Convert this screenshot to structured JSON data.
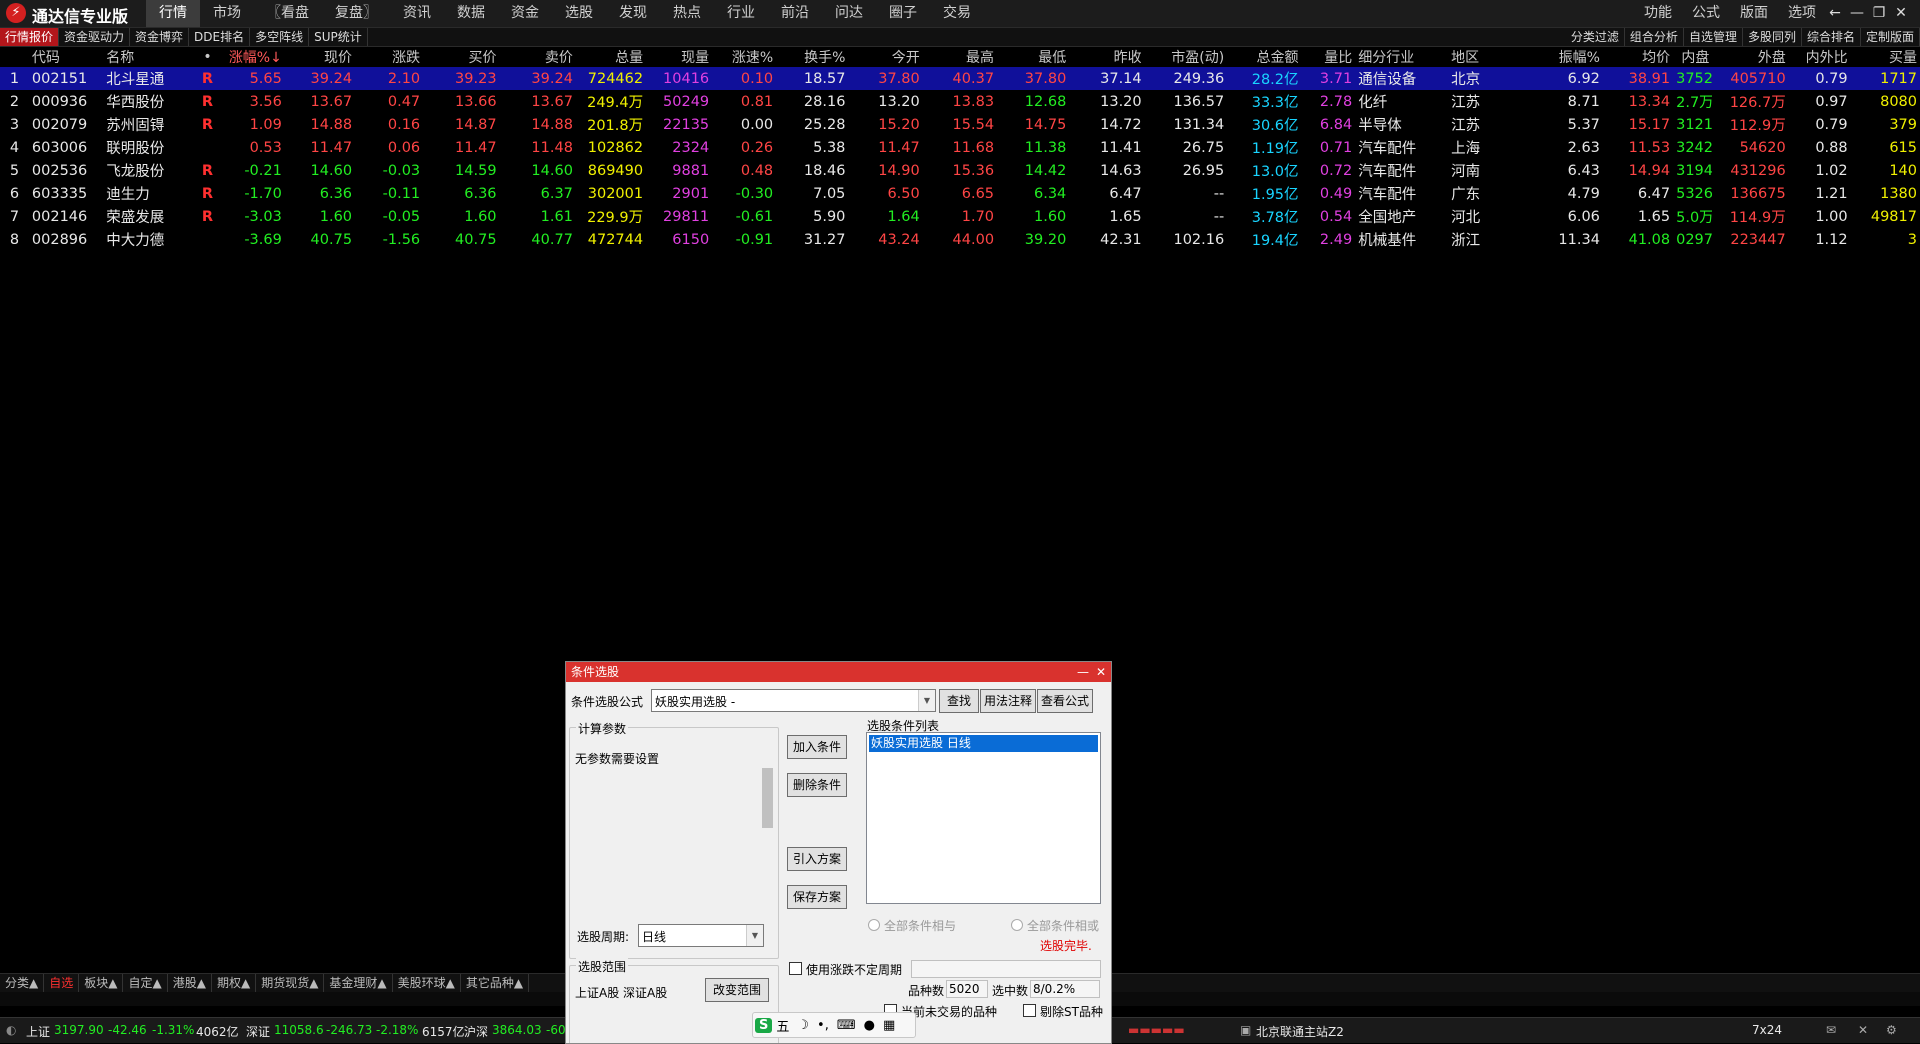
{
  "app": {
    "logo_icon": "tdx-logo-icon",
    "title": "通达信专业版",
    "menu": [
      "行情",
      "市场",
      "〖看盘",
      "复盘〗",
      "资讯",
      "数据",
      "资金",
      "选股",
      "发现",
      "热点",
      "行业",
      "前沿",
      "问达",
      "圈子",
      "交易"
    ],
    "right_menu": [
      "功能",
      "公式",
      "版面",
      "选项"
    ],
    "window_controls": [
      "←",
      "—",
      "❐",
      "✕"
    ]
  },
  "subtabs": [
    "行情报价",
    "资金驱动力",
    "资金博弈",
    "DDE排名",
    "多空阵线",
    "SUP统计"
  ],
  "subtabs_right": [
    "分类过滤",
    "组合分析",
    "自选管理",
    "多股同列",
    "综合排名",
    "定制版面"
  ],
  "table": {
    "headers": [
      "",
      "代码",
      "名称",
      "•",
      "涨幅%↓",
      "现价",
      "涨跌",
      "买价",
      "卖价",
      "总量",
      "现量",
      "涨速%",
      "换手%",
      "今开",
      "最高",
      "最低",
      "昨收",
      "市盈(动)",
      "总金额",
      "量比",
      "细分行业",
      "地区",
      "振幅%",
      "均价",
      "内盘",
      "外盘",
      "内外比",
      "买量"
    ],
    "rows": [
      [
        "1",
        "002151",
        "北斗星通",
        "R",
        "5.65",
        "39.24",
        "2.10",
        "39.23",
        "39.24",
        "724462",
        "10416",
        "0.10",
        "18.57",
        "37.80",
        "40.37",
        "37.80",
        "37.14",
        "249.36",
        "28.2亿",
        "3.71",
        "通信设备",
        "北京",
        "6.92",
        "38.91",
        "3752",
        "405710",
        "0.79",
        "1717"
      ],
      [
        "2",
        "000936",
        "华西股份",
        "R",
        "3.56",
        "13.67",
        "0.47",
        "13.66",
        "13.67",
        "249.4万",
        "50249",
        "0.81",
        "28.16",
        "13.20",
        "13.83",
        "12.68",
        "13.20",
        "136.57",
        "33.3亿",
        "2.78",
        "化纤",
        "江苏",
        "8.71",
        "13.34",
        "2.7万",
        "126.7万",
        "0.97",
        "8080"
      ],
      [
        "3",
        "002079",
        "苏州固锝",
        "R",
        "1.09",
        "14.88",
        "0.16",
        "14.87",
        "14.88",
        "201.8万",
        "22135",
        "0.00",
        "25.28",
        "15.20",
        "15.54",
        "14.75",
        "14.72",
        "131.34",
        "30.6亿",
        "6.84",
        "半导体",
        "江苏",
        "5.37",
        "15.17",
        "3121",
        "112.9万",
        "0.79",
        "379"
      ],
      [
        "4",
        "603006",
        "联明股份",
        "",
        "0.53",
        "11.47",
        "0.06",
        "11.47",
        "11.48",
        "102862",
        "2324",
        "0.26",
        "5.38",
        "11.47",
        "11.68",
        "11.38",
        "11.41",
        "26.75",
        "1.19亿",
        "0.71",
        "汽车配件",
        "上海",
        "2.63",
        "11.53",
        "3242",
        "54620",
        "0.88",
        "615"
      ],
      [
        "5",
        "002536",
        "飞龙股份",
        "R",
        "-0.21",
        "14.60",
        "-0.03",
        "14.59",
        "14.60",
        "869490",
        "9881",
        "0.48",
        "18.46",
        "14.90",
        "15.36",
        "14.42",
        "14.63",
        "26.95",
        "13.0亿",
        "0.72",
        "汽车配件",
        "河南",
        "6.43",
        "14.94",
        "3194",
        "431296",
        "1.02",
        "140"
      ],
      [
        "6",
        "603335",
        "迪生力",
        "R",
        "-1.70",
        "6.36",
        "-0.11",
        "6.36",
        "6.37",
        "302001",
        "2901",
        "-0.30",
        "7.05",
        "6.50",
        "6.65",
        "6.34",
        "6.47",
        "--",
        "1.95亿",
        "0.49",
        "汽车配件",
        "广东",
        "4.79",
        "6.47",
        "5326",
        "136675",
        "1.21",
        "1380"
      ],
      [
        "7",
        "002146",
        "荣盛发展",
        "R",
        "-3.03",
        "1.60",
        "-0.05",
        "1.60",
        "1.61",
        "229.9万",
        "29811",
        "-0.61",
        "5.90",
        "1.64",
        "1.70",
        "1.60",
        "1.65",
        "--",
        "3.78亿",
        "0.54",
        "全国地产",
        "河北",
        "6.06",
        "1.65",
        "5.0万",
        "114.9万",
        "1.00",
        "49817"
      ],
      [
        "8",
        "002896",
        "中大力德",
        "",
        "-3.69",
        "40.75",
        "-1.56",
        "40.75",
        "40.77",
        "472744",
        "6150",
        "-0.91",
        "31.27",
        "43.24",
        "44.00",
        "39.20",
        "42.31",
        "102.16",
        "19.4亿",
        "2.49",
        "机械基件",
        "浙江",
        "11.34",
        "41.08",
        "0297",
        "223447",
        "1.12",
        "3"
      ]
    ]
  },
  "bottom_tabs": [
    "分类▲",
    "自选",
    "板块▲",
    "自定▲",
    "港股▲",
    "期权▲",
    "期货现货▲",
    "基金理财▲",
    "美股环球▲",
    "其它品种▲"
  ],
  "status": {
    "sh_label": "上证",
    "sh_index": "3197.90",
    "sh_change": "-42.46",
    "sh_pct": "-1.31%",
    "sh_amount": "4062亿",
    "sz_label": "深证",
    "sz_index": "11058.6",
    "sz_change": "-246.73",
    "sz_pct": "-2.18%",
    "sz_amount": "6157亿",
    "hs_label": "沪深",
    "hs_index": "3864.03",
    "hs_change": "-60",
    "server": "北京联通主站Z2",
    "mode": "7x24"
  },
  "dialog": {
    "title": "条件选股",
    "title_controls": [
      "—",
      "✕"
    ],
    "formula_label": "条件选股公式",
    "formula_value": "妖股实用选股 -",
    "btn_find": "查找",
    "btn_usage": "用法注释",
    "btn_view": "查看公式",
    "params_group": "计算参数",
    "params_text": "无参数需要设置",
    "btn_add": "加入条件",
    "btn_delete": "删除条件",
    "btn_import": "引入方案",
    "btn_save": "保存方案",
    "cond_list_label": "选股条件列表",
    "cond_list": [
      "妖股实用选股  日线"
    ],
    "period_label": "选股周期:",
    "period_value": "日线",
    "radio_and": "全部条件相与",
    "radio_or": "全部条件相或",
    "done_text": "选股完毕.",
    "range_group": "选股范围",
    "range_text": "上证A股 深证A股",
    "btn_change_range": "改变范围",
    "chk_uncertain": "使用涨跌不定周期",
    "count_label": "品种数",
    "count_value": "5020",
    "selected_label": "选中数",
    "selected_value": "8/0.2%",
    "chk_not_traded": "当前未交易的品种",
    "chk_st": "剔除ST品种"
  },
  "ime": {
    "icon": "sogou-ime-icon",
    "mode": "五",
    "moon": "☽",
    "punct": "•,"
  }
}
